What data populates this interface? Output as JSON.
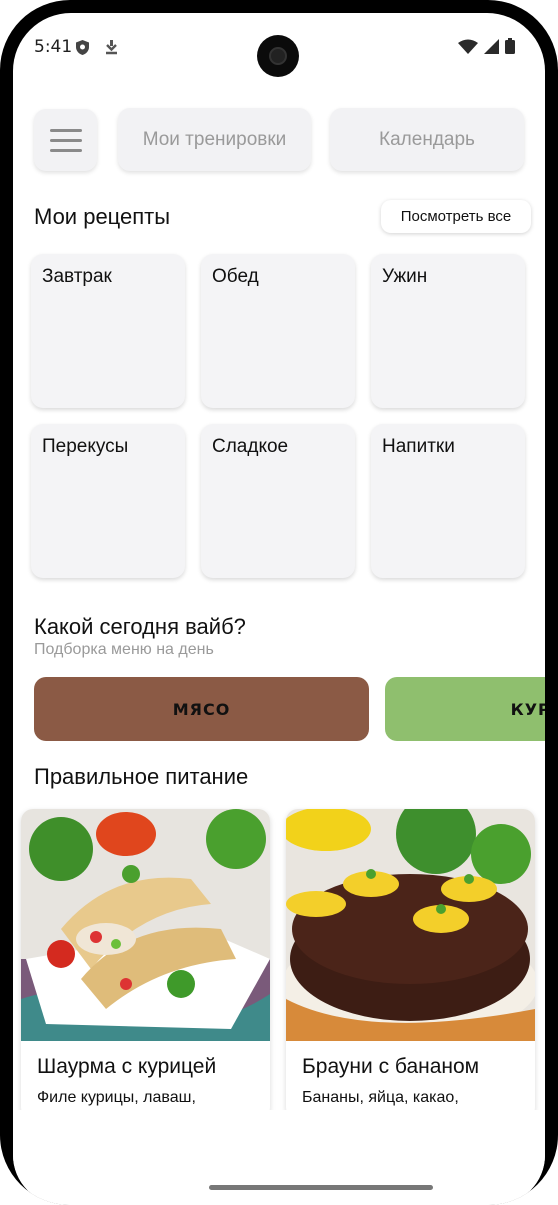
{
  "status_bar": {
    "time": "5:41"
  },
  "topbar": {
    "my_workouts": "Мои тренировки",
    "calendar": "Календарь"
  },
  "recipes": {
    "title": "Мои рецепты",
    "see_all": "Посмотреть все",
    "categories": [
      "Завтрак",
      "Обед",
      "Ужин",
      "Перекусы",
      "Сладкое",
      "Напитки"
    ]
  },
  "vibe": {
    "title": "Какой сегодня вайб?",
    "subtitle": "Подборка меню на день",
    "options": [
      {
        "label": "МЯСО",
        "color": "#8b5a45"
      },
      {
        "label": "КУРИЦА",
        "color": "#8fbf6e"
      }
    ]
  },
  "healthy": {
    "title": "Правильное питание",
    "cards": [
      {
        "name": "Шаурма с курицей",
        "desc": "Филе курицы, лаваш,"
      },
      {
        "name": "Брауни с бананом",
        "desc": "Бананы, яйца, какао,"
      }
    ]
  }
}
